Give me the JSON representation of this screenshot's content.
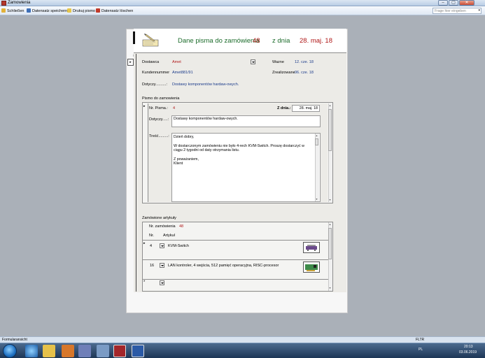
{
  "window": {
    "title": "Zamowienia",
    "minimize": "–",
    "maximize": "▢",
    "close": "✕"
  },
  "toolbar": {
    "close_label": "Schließen",
    "save_label": "Datensatz speichern",
    "print_label": "Drukuj pismo",
    "delete_label": "Datensatz löschen",
    "help_placeholder": "Frage hier eingeben"
  },
  "header": {
    "title": "Dane pisma do zamówienia",
    "order_number": "48",
    "date_prefix": "z dnia",
    "date": "28. maj. 18"
  },
  "main": {
    "supplier_label": "Dostawca",
    "supplier_value": "Amet",
    "customer_number_label": "Kundennummer",
    "customer_number_value": "Amet881/91",
    "subject_label": "Dotyczy..........:",
    "subject_value": "Dostawy komponentów hardaw-owych.",
    "valid_label": "Wazne",
    "valid_value": "12. cze. 18",
    "completed_label": "Zrealizowane",
    "completed_value": "06. cze. 18"
  },
  "letter": {
    "section_title": "Pismo do zamowienia",
    "number_label": "Nr. Pisma.:",
    "number_value": "4",
    "date_label": "Z dnia.:",
    "date_value": "28. maj. 18",
    "subject_label": "Dotyczy.....:",
    "subject_value": "Dostawy komponentów hardaw-owych.",
    "body_label": "Treść.........:",
    "body_lines": [
      "Dzień dobry,",
      "",
      "W dostarczonym zamówieniu nie było 4-rech KVM-Switch. Proszę dostarczyć w",
      "ciągu 2 tygodni od daty otrzymania listu.",
      "",
      "Z poważaniem,",
      "Klient"
    ]
  },
  "items": {
    "section_title": "Zamówione artykuły",
    "order_number_label": "Nr. zamówienia",
    "order_number_value": "48",
    "col_nr": "Nr.",
    "col_article": "Artykuł",
    "rows": [
      {
        "nr": "4",
        "article": "KVM-Switch"
      },
      {
        "nr": "16",
        "article": "LAN kontroler, 4 wejścia, 512 pamięć operacyjna, RISC-procesor"
      }
    ]
  },
  "statusbar": {
    "left": "Formularansicht",
    "right": "FLTR"
  },
  "taskbar": {
    "locale": "PL",
    "time": "20:13",
    "date": "03.06.2019"
  }
}
